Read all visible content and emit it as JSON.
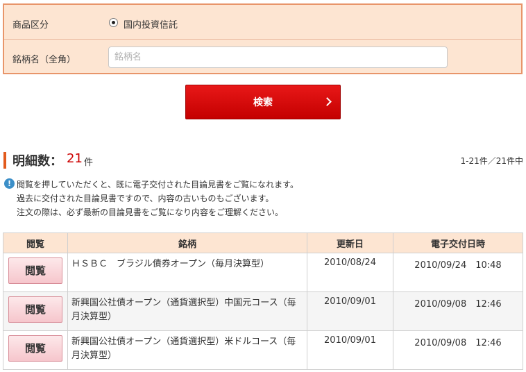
{
  "form": {
    "category_label": "商品区分",
    "category_option": "国内投資信託",
    "name_label": "銘柄名（全角）",
    "name_placeholder": "銘柄名",
    "name_value": ""
  },
  "search_button": "検索",
  "results": {
    "count_title": "明細数：",
    "count": "21",
    "count_unit": "件",
    "pagination": "1-21件／21件中"
  },
  "notice": {
    "icon": "info-icon",
    "lines": [
      "閲覧を押していただくと、既に電子交付された目論見書をご覧になれます。",
      "過去に交付された目論見書ですので、内容の古いものもございます。",
      "注文の際は、必ず最新の目論見書をご覧になり内容をご理解ください。"
    ]
  },
  "table": {
    "headers": [
      "閲覧",
      "銘柄",
      "更新日",
      "電子交付日時"
    ],
    "rows": [
      {
        "button": "閲覧",
        "name": "ＨＳＢＣ　ブラジル債券オープン（毎月決算型）",
        "updated": "2010/08/24",
        "delivered": "2010/09/24　10:48"
      },
      {
        "button": "閲覧",
        "name": "新興国公社債オープン（通貨選択型）中国元コース（毎月決算型）",
        "updated": "2010/09/01",
        "delivered": "2010/09/08　12:46"
      },
      {
        "button": "閲覧",
        "name": "新興国公社債オープン（通貨選択型）米ドルコース（毎月決算型）",
        "updated": "2010/09/01",
        "delivered": "2010/09/08　12:46"
      }
    ]
  },
  "colors": {
    "form_bg": "#fde5d2",
    "form_border": "#e8956a",
    "primary_red": "#d60a0a",
    "count_red": "#cc0000",
    "accent_bar": "#e25a1c",
    "info_blue": "#3c8fc8",
    "view_button_bg": "#f6c6cc"
  }
}
